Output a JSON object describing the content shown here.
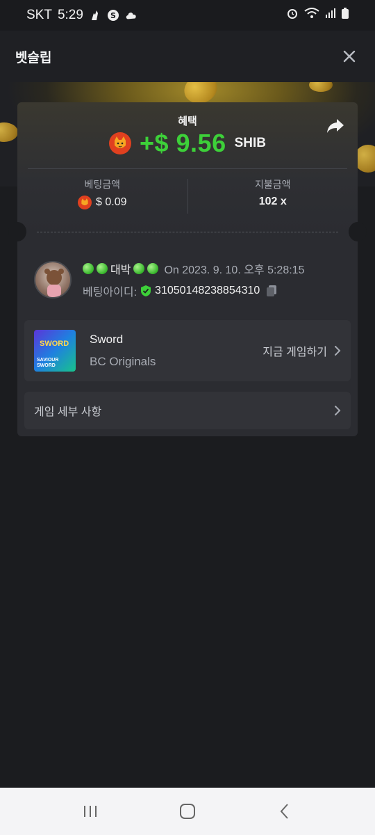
{
  "status_bar": {
    "carrier": "SKT",
    "time": "5:29"
  },
  "header": {
    "title": "벳슬립"
  },
  "bet": {
    "benefit_label": "혜택",
    "amount": "+$ 9.56",
    "currency": "SHIB",
    "bet_amount_label": "베팅금액",
    "bet_amount": "$ 0.09",
    "payout_label": "지불금액",
    "payout": "102 x"
  },
  "user": {
    "name": "대박",
    "timestamp": "On 2023. 9. 10. 오후 5:28:15",
    "bet_id_label": "베팅아이디:",
    "bet_id": "31050148238854310"
  },
  "game": {
    "thumb_title": "SWORD",
    "thumb_subtitle": "SAVIOUR SWORD",
    "name": "Sword",
    "provider": "BC Originals",
    "play_label": "지금 게임하기"
  },
  "details": {
    "label": "게임 세부 사항"
  },
  "colors": {
    "accent_green": "#3dd039",
    "background": "#1b1c1f",
    "card": "#2b2c31"
  }
}
